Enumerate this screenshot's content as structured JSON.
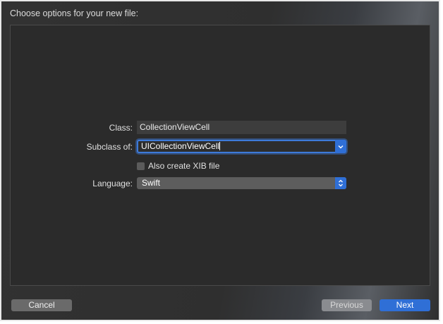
{
  "dialog": {
    "title": "Choose options for your new file:"
  },
  "form": {
    "class_label": "Class:",
    "class_value": "CollectionViewCell",
    "subclass_label": "Subclass of:",
    "subclass_value": "UICollectionViewCell",
    "xib_label": "Also create XIB file",
    "xib_checked": false,
    "language_label": "Language:",
    "language_value": "Swift"
  },
  "buttons": {
    "cancel": "Cancel",
    "previous": "Previous",
    "next": "Next"
  },
  "colors": {
    "accent": "#2f6fd6",
    "background": "#2b2b2b"
  },
  "icons": {
    "combo": "chevron-down-icon",
    "popup": "up-down-arrows-icon"
  }
}
